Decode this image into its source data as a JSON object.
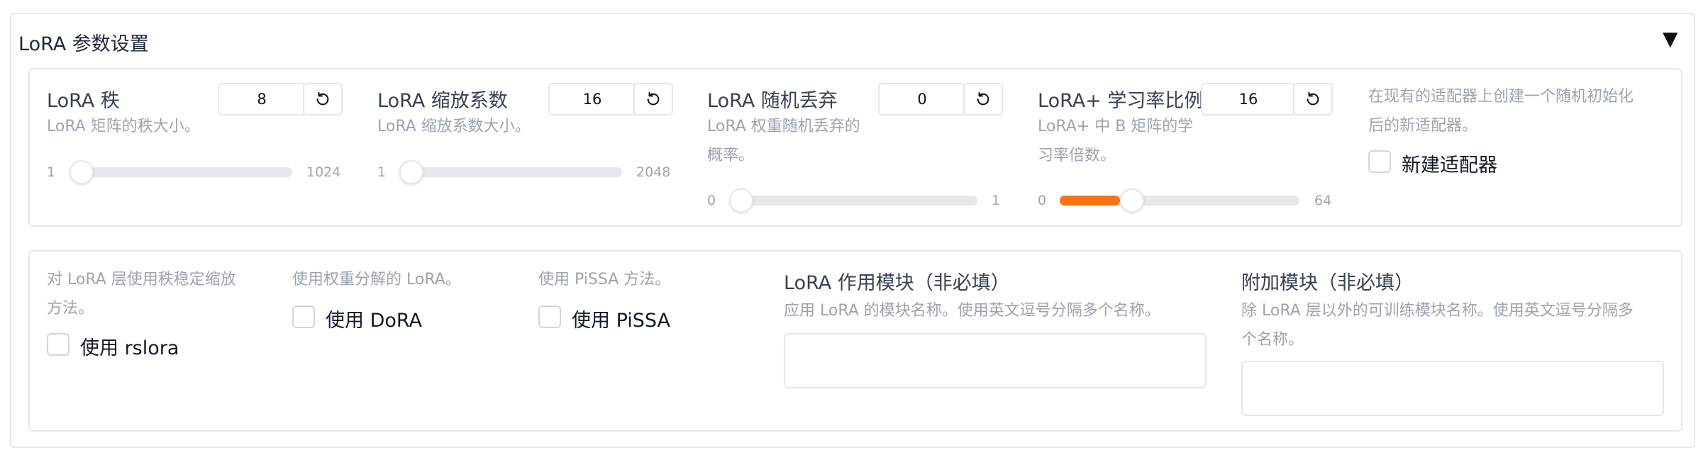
{
  "accordion": {
    "title": "LoRA 参数设置",
    "toggle": "▼"
  },
  "sliders": [
    {
      "label": "LoRA 秩",
      "info": [
        "LoRA 矩阵的秩大小。"
      ],
      "value": "8",
      "min": "1",
      "max": "1024"
    },
    {
      "label": "LoRA 缩放系数",
      "info": [
        "LoRA 缩放系数大小。"
      ],
      "value": "16",
      "min": "1",
      "max": "2048"
    },
    {
      "label": "LoRA 随机丢弃",
      "info": [
        "LoRA 权重随机丢弃的",
        "概率。"
      ],
      "value": "0",
      "min": "0",
      "max": "1"
    },
    {
      "label": "LoRA+ 学习率比例",
      "info": [
        "LoRA+ 中 B 矩阵的学",
        "习率倍数。"
      ],
      "value": "16",
      "min": "0",
      "max": "64",
      "fill_percent": 25
    }
  ],
  "create_new_adapter": {
    "info": [
      "在现有的适配器上创建一个随机初始化",
      "后的新适配器。"
    ],
    "label": "新建适配器",
    "checked": false
  },
  "checkboxes": [
    {
      "info": [
        "对 LoRA 层使用秩稳定缩放",
        "方法。"
      ],
      "label": "使用 rslora",
      "checked": false
    },
    {
      "info": [
        "使用权重分解的 LoRA。"
      ],
      "label": "使用 DoRA",
      "checked": false
    },
    {
      "info": [
        "使用 PiSSA 方法。"
      ],
      "label": "使用 PiSSA",
      "checked": false
    }
  ],
  "lora_target": {
    "label": "LoRA 作用模块（非必填）",
    "info": [
      "应用 LoRA 的模块名称。使用英文逗号分隔多个名称。"
    ],
    "value": ""
  },
  "additional_target": {
    "label": "附加模块（非必填）",
    "info": [
      "除 LoRA 层以外的可训练模块名称。使用英文逗号分隔多",
      "个名称。"
    ],
    "value": ""
  },
  "colors": {
    "accent": "#f97316",
    "border": "#e5e7eb",
    "info_text": "#9ca3af"
  },
  "icons": {
    "reset": "reset-icon",
    "toggle": "triangle-down-icon"
  }
}
